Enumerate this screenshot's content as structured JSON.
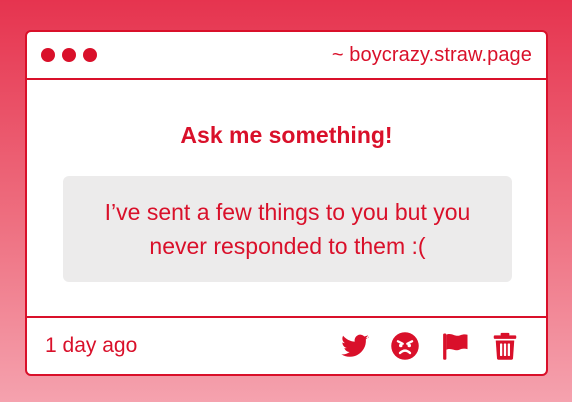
{
  "window": {
    "url": "~ boycrazy.straw.page"
  },
  "main": {
    "prompt": "Ask me something!",
    "question": "I’ve sent a few things to you but you never responded to them :("
  },
  "footer": {
    "timestamp": "1 day ago",
    "actions": [
      "twitter-icon",
      "angry-face-icon",
      "flag-icon",
      "trash-icon"
    ]
  },
  "colors": {
    "accent": "#d9102a",
    "question_bg": "#ecebeb",
    "card_bg": "#ffffff"
  }
}
